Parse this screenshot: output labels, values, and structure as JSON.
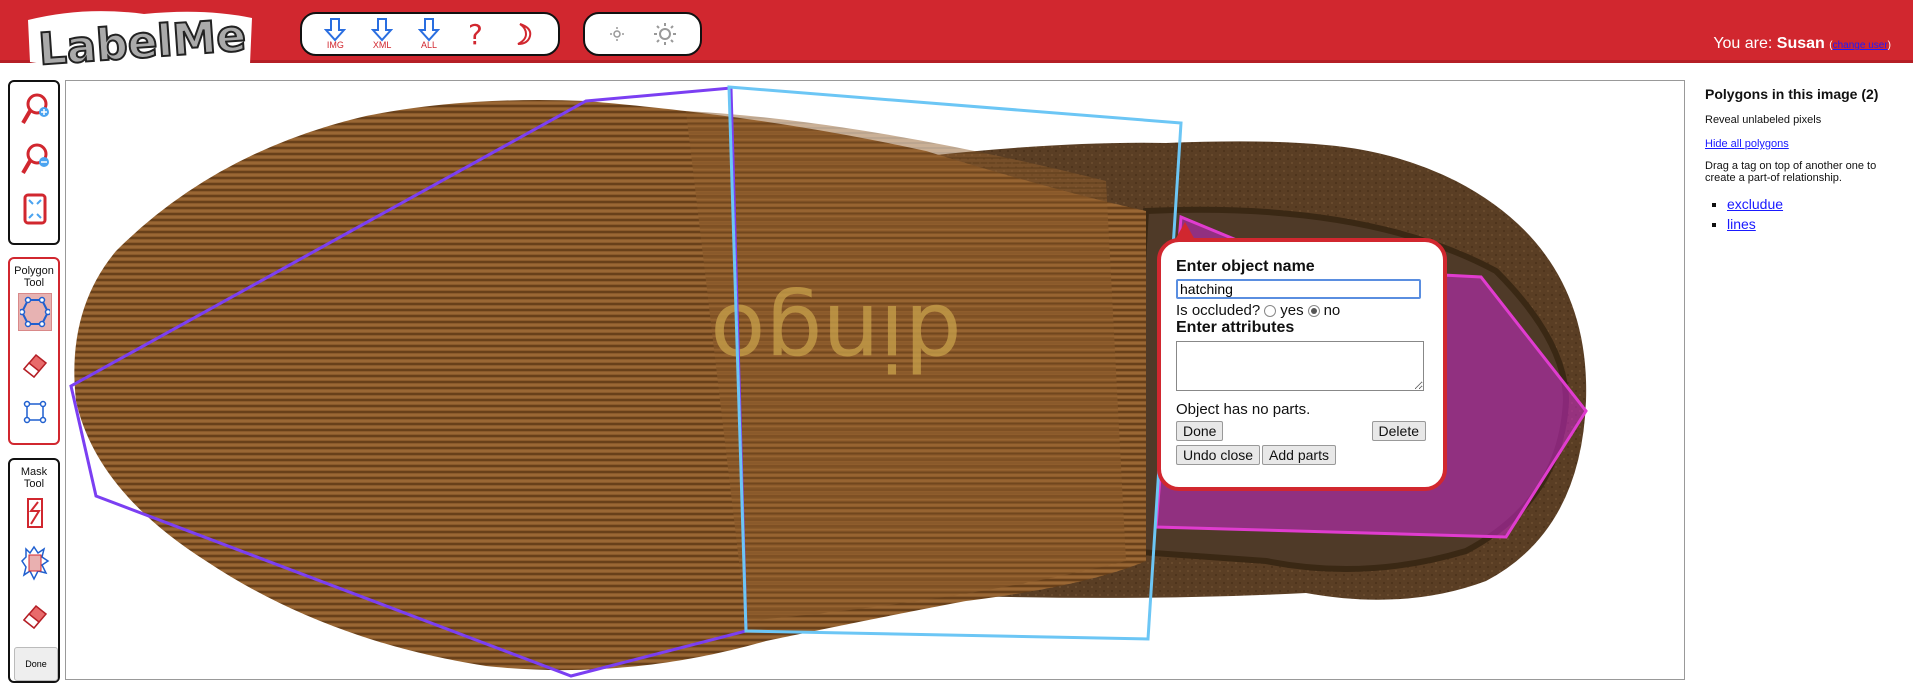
{
  "header": {
    "logo_text": "LabelMe",
    "toolbar": [
      {
        "name": "download-img-button",
        "icon": "down-arrow-icon",
        "label": "IMG"
      },
      {
        "name": "download-xml-button",
        "icon": "down-arrow-icon",
        "label": "XML"
      },
      {
        "name": "download-all-button",
        "icon": "down-arrow-icon",
        "label": "ALL"
      },
      {
        "name": "help-button",
        "icon": "question-icon",
        "label": ""
      },
      {
        "name": "night-mode-button",
        "icon": "moon-icon",
        "label": ""
      }
    ],
    "user_prefix": "You are:",
    "user_name": "Susan",
    "change_user": "change user",
    "accent": "#d1272f"
  },
  "left_panels": {
    "polygon_tool_title": "Polygon Tool",
    "mask_tool_title": "Mask Tool",
    "done_label": "Done"
  },
  "popup": {
    "title": "Enter object name",
    "name_value": "hatching",
    "occluded_label": "Is occluded?",
    "yes_label": "yes",
    "no_label": "no",
    "occluded": "no",
    "attributes_label": "Enter attributes",
    "attributes_value": "",
    "parts_text": "Object has no parts.",
    "done_button": "Done",
    "delete_button": "Delete",
    "undo_close_button": "Undo close",
    "add_parts_button": "Add parts"
  },
  "right_panel": {
    "title": "Polygons in this image (2)",
    "reveal_text": "Reveal unlabeled pixels",
    "hide_link": "Hide all polygons",
    "drag_text": "Drag a tag on top of another one to create a part-of relationship.",
    "polygons": [
      "excludue",
      "lines"
    ]
  },
  "image": {
    "sole_text": "dingo",
    "polygon_colors": {
      "excludue": "#7b3ff2",
      "lines": "#6cc6f5",
      "hatching": "#e03ccf"
    }
  }
}
